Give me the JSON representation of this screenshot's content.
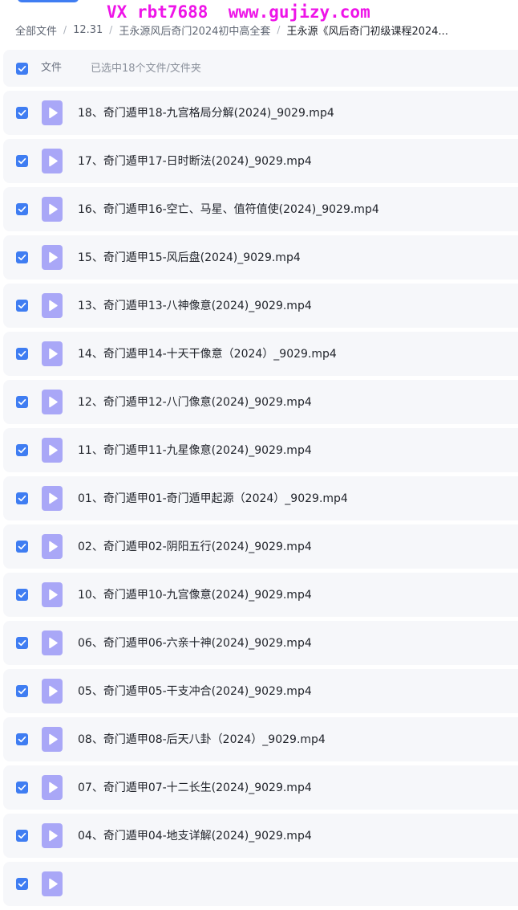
{
  "watermark": "VX rbt7688  www.gujizy.com",
  "breadcrumb": [
    "全部文件",
    "12.31",
    "王永源风后奇门2024初中高全套",
    "王永源《风后奇门初级课程2024..."
  ],
  "header": {
    "column_label": "文件",
    "selection_status": "已选中18个文件/文件夹"
  },
  "colors": {
    "accent": "#3f7df2",
    "video_icon": "#a9a7f7",
    "row_bg": "#f6f7fa",
    "watermark": "#ee14e8"
  },
  "icons": {
    "file": "video-file-icon",
    "checkbox": "checked-checkbox"
  },
  "files": [
    "18、奇门遁甲18-九宫格局分解(2024)_9029.mp4",
    "17、奇门遁甲17-日时断法(2024)_9029.mp4",
    "16、奇门遁甲16-空亡、马星、值符值使(2024)_9029.mp4",
    "15、奇门遁甲15-风后盘(2024)_9029.mp4",
    "13、奇门遁甲13-八神像意(2024)_9029.mp4",
    "14、奇门遁甲14-十天干像意（2024）_9029.mp4",
    "12、奇门遁甲12-八门像意(2024)_9029.mp4",
    "11、奇门遁甲11-九星像意(2024)_9029.mp4",
    "01、奇门遁甲01-奇门遁甲起源（2024）_9029.mp4",
    "02、奇门遁甲02-阴阳五行(2024)_9029.mp4",
    "10、奇门遁甲10-九宫像意(2024)_9029.mp4",
    "06、奇门遁甲06-六亲十神(2024)_9029.mp4",
    "05、奇门遁甲05-干支冲合(2024)_9029.mp4",
    "08、奇门遁甲08-后天八卦（2024）_9029.mp4",
    "07、奇门遁甲07-十二长生(2024)_9029.mp4",
    "04、奇门遁甲04-地支详解(2024)_9029.mp4",
    ""
  ]
}
